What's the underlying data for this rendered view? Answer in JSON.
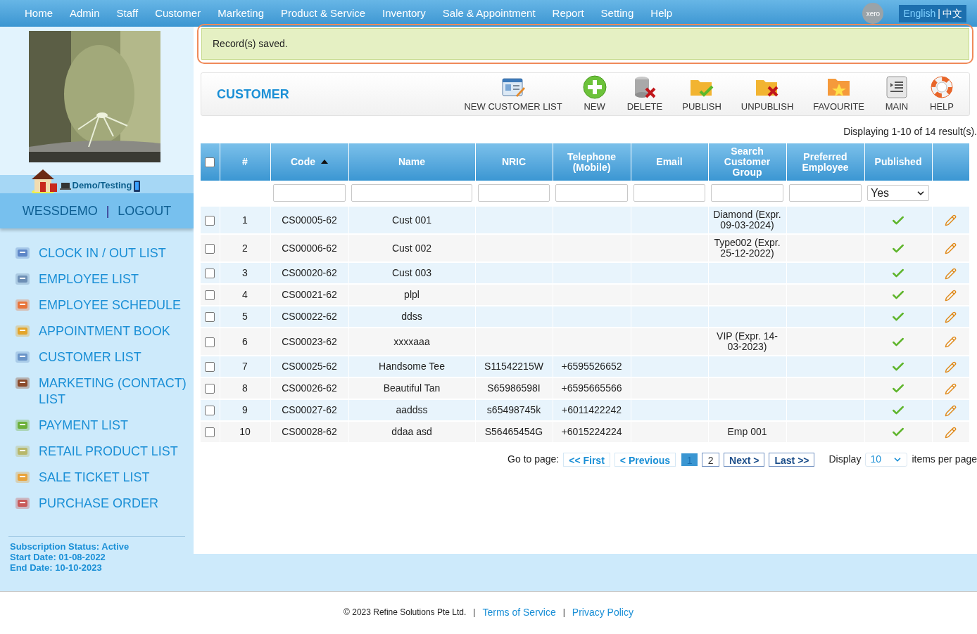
{
  "nav": {
    "items": [
      {
        "label": "Home"
      },
      {
        "label": "Admin"
      },
      {
        "label": "Staff"
      },
      {
        "label": "Customer"
      },
      {
        "label": "Marketing"
      },
      {
        "label": "Product & Service"
      },
      {
        "label": "Inventory"
      },
      {
        "label": "Sale & Appointment"
      },
      {
        "label": "Report"
      },
      {
        "label": "Setting"
      },
      {
        "label": "Help"
      }
    ],
    "xero": "xero",
    "language": {
      "english": "English",
      "separator": "|",
      "chinese": "中文"
    }
  },
  "message": "Record(s) saved.",
  "sidebar": {
    "site_label": "Demo/Testing",
    "user": "WESSDEMO",
    "separator": "|",
    "logout": "LOGOUT",
    "menu": [
      {
        "label": "CLOCK IN / OUT LIST"
      },
      {
        "label": "EMPLOYEE LIST"
      },
      {
        "label": "EMPLOYEE SCHEDULE"
      },
      {
        "label": "APPOINTMENT BOOK"
      },
      {
        "label": "CUSTOMER LIST"
      },
      {
        "label": "MARKETING (CONTACT) LIST"
      },
      {
        "label": "PAYMENT LIST"
      },
      {
        "label": "RETAIL PRODUCT LIST"
      },
      {
        "label": "SALE TICKET LIST"
      },
      {
        "label": "PURCHASE ORDER"
      }
    ],
    "subscription": [
      "Subscription Status: Active",
      "Start Date: 01-08-2022",
      "End Date: 10-10-2023"
    ]
  },
  "toolbar": {
    "title": "CUSTOMER",
    "actions": [
      {
        "label": "NEW CUSTOMER LIST"
      },
      {
        "label": "NEW"
      },
      {
        "label": "DELETE"
      },
      {
        "label": "PUBLISH"
      },
      {
        "label": "UNPUBLISH"
      },
      {
        "label": "FAVOURITE"
      },
      {
        "label": "MAIN"
      },
      {
        "label": "HELP"
      }
    ]
  },
  "result_count": "Displaying 1-10 of 14 result(s).",
  "table": {
    "select_all_checked": false,
    "columns": [
      {
        "label": "#"
      },
      {
        "label": "Code",
        "sorted": true,
        "filter": {
          "kind": "text"
        }
      },
      {
        "label": "Name",
        "filter": {
          "kind": "text"
        }
      },
      {
        "label": "NRIC",
        "filter": {
          "kind": "text"
        }
      },
      {
        "label": "Telephone (Mobile)",
        "filter": {
          "kind": "text"
        }
      },
      {
        "label": "Email",
        "filter": {
          "kind": "text"
        }
      },
      {
        "label": "Search Customer Group",
        "filter": {
          "kind": "text"
        }
      },
      {
        "label": "Preferred Employee",
        "filter": {
          "kind": "text"
        }
      },
      {
        "label": "Published",
        "filter": {
          "kind": "select",
          "value": "Yes"
        }
      }
    ],
    "rows": [
      {
        "checked": false,
        "cells": [
          "1",
          "CS00005-62",
          "Cust 001",
          "",
          "",
          "",
          "Diamond (Expr. 09-03-2024)",
          ""
        ],
        "published": true
      },
      {
        "checked": false,
        "cells": [
          "2",
          "CS00006-62",
          "Cust 002",
          "",
          "",
          "",
          "Type002 (Expr. 25-12-2022)",
          ""
        ],
        "published": true
      },
      {
        "checked": false,
        "cells": [
          "3",
          "CS00020-62",
          "Cust 003",
          "",
          "",
          "",
          "",
          ""
        ],
        "published": true
      },
      {
        "checked": false,
        "cells": [
          "4",
          "CS00021-62",
          "plpl",
          "",
          "",
          "",
          "",
          ""
        ],
        "published": true
      },
      {
        "checked": false,
        "cells": [
          "5",
          "CS00022-62",
          "ddss",
          "",
          "",
          "",
          "",
          ""
        ],
        "published": true
      },
      {
        "checked": false,
        "cells": [
          "6",
          "CS00023-62",
          "xxxxaaa",
          "",
          "",
          "",
          "VIP (Expr. 14-03-2023)",
          ""
        ],
        "published": true
      },
      {
        "checked": false,
        "cells": [
          "7",
          "CS00025-62",
          "Handsome Tee",
          "S11542215W",
          "+6595526652",
          "",
          "",
          ""
        ],
        "published": true
      },
      {
        "checked": false,
        "cells": [
          "8",
          "CS00026-62",
          "Beautiful Tan",
          "S65986598I",
          "+6595665566",
          "",
          "",
          ""
        ],
        "published": true
      },
      {
        "checked": false,
        "cells": [
          "9",
          "CS00027-62",
          "aaddss",
          "s65498745k",
          "+6011422242",
          "",
          "",
          ""
        ],
        "published": true
      },
      {
        "checked": false,
        "cells": [
          "10",
          "CS00028-62",
          "ddaa asd",
          "S56465454G",
          "+6015224224",
          "",
          "Emp 001",
          ""
        ],
        "published": true
      }
    ]
  },
  "pagination": {
    "goto_label": "Go to page:",
    "first": "<< First",
    "previous": "< Previous",
    "pages": [
      {
        "label": "1",
        "selected": true
      },
      {
        "label": "2",
        "selected": false
      }
    ],
    "next": "Next >",
    "last": "Last >>",
    "display_label": "Display",
    "per_page": "10",
    "per_page_suffix": "items per page"
  },
  "footer": {
    "copyright": "© 2023 Refine Solutions Pte Ltd.",
    "separator": "|",
    "links": [
      "Terms of Service",
      "Privacy Policy"
    ]
  }
}
